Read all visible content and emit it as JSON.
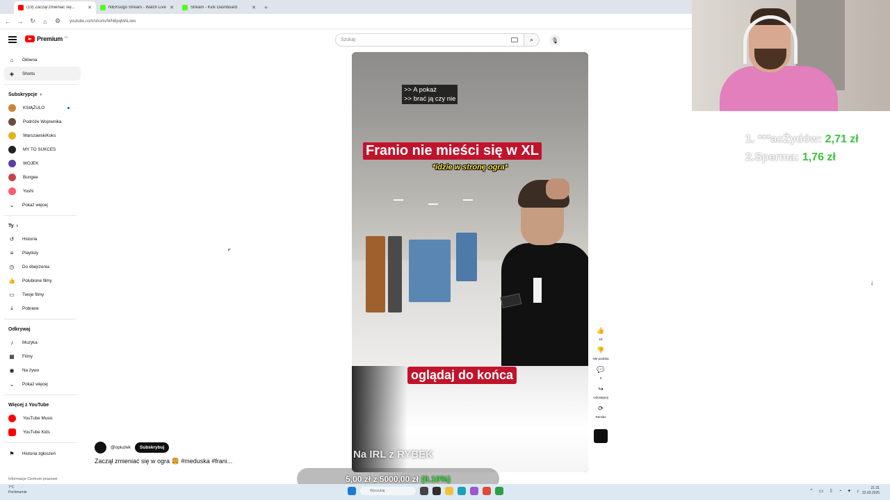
{
  "browser": {
    "tabs": [
      {
        "label": "(19) Zaczął zmieniać się...",
        "color": "#ff0000"
      },
      {
        "label": "NIEKsogo Stream - Watch Live",
        "color": "#53fc18"
      },
      {
        "label": "Stream - Kick Dashboard",
        "color": "#53fc18"
      }
    ],
    "new_tab": "+",
    "url": "youtube.com/shorts/WN6pqMALiwo"
  },
  "masthead": {
    "logo_text": "Premium",
    "logo_sup": "PL",
    "search_placeholder": "Szukaj"
  },
  "sidebar": {
    "main": [
      {
        "label": "Główna",
        "icon": "home-icon"
      },
      {
        "label": "Shorts",
        "icon": "shorts-icon",
        "active": true
      }
    ],
    "subs_header": "Subskrypcje",
    "subscriptions": [
      {
        "label": "KSIĄŻULO",
        "color": "#c9863a",
        "new": true
      },
      {
        "label": "Podróże Wojownika",
        "color": "#6a4b3a"
      },
      {
        "label": "WarszawskiKoks",
        "color": "#e8b21a"
      },
      {
        "label": "MY TO SUKCES",
        "color": "#222222"
      },
      {
        "label": "WOJEK",
        "color": "#5a3fa0"
      },
      {
        "label": "Bungee",
        "color": "#c8424a"
      },
      {
        "label": "Yoshi",
        "color": "#ff5a6e"
      }
    ],
    "subs_more": "Pokaż więcej",
    "you_header": "Ty",
    "you": [
      {
        "label": "Historia",
        "icon": "history-icon"
      },
      {
        "label": "Playlisty",
        "icon": "playlist-icon"
      },
      {
        "label": "Do obejrzenia",
        "icon": "watch-later-icon"
      },
      {
        "label": "Polubione filmy",
        "icon": "like-icon"
      },
      {
        "label": "Twoje filmy",
        "icon": "your-videos-icon"
      },
      {
        "label": "Pobrane",
        "icon": "download-icon"
      }
    ],
    "explore_header": "Odkrywaj",
    "explore": [
      {
        "label": "Muzyka",
        "icon": "music-icon"
      },
      {
        "label": "Filmy",
        "icon": "film-icon"
      },
      {
        "label": "Na żywo",
        "icon": "live-icon"
      },
      {
        "label": "Pokaż więcej",
        "icon": "chevron-down-icon"
      }
    ],
    "more_header": "Więcej z YouTube",
    "more": [
      {
        "label": "YouTube Music",
        "color": "#ff0000"
      },
      {
        "label": "YouTube Kids",
        "color": "#ff0000"
      }
    ],
    "report": "Historia zgłoszeń",
    "footer": "Informacje   Centrum prasowe"
  },
  "short": {
    "cc_lines": [
      ">> A pokaż",
      ">> brać ją czy nie"
    ],
    "title_overlay": "Franio nie mieści się w XL",
    "subtitle_overlay": "*idzie w stronę ogra*",
    "bottom_overlay": "oglądaj do końca",
    "watermark": "Na IRL z RYBEK",
    "channel": "@opiuzek",
    "subscribe": "Subskrybuj",
    "title": "Zaczął zmieniać się w ogra 🍔 #meduska #frani..."
  },
  "actions": [
    {
      "label": "19",
      "icon": "thumbs-up-icon"
    },
    {
      "label": "Nie podoba",
      "icon": "thumbs-down-icon"
    },
    {
      "label": "0",
      "icon": "comment-icon"
    },
    {
      "label": "Udostępnij",
      "icon": "share-icon"
    },
    {
      "label": "Remiks",
      "icon": "remix-icon"
    }
  ],
  "stream": {
    "leaderboard": [
      {
        "rank": "1. ***acŻydów:",
        "amount": "2,71 zł"
      },
      {
        "rank": "2.Sperma:",
        "amount": "1,76 zł"
      }
    ],
    "goal_text": "5,00 zł z 5000,00 zł",
    "goal_pct": "(0.10%)",
    "goal_fraction": 0.001
  },
  "taskbar": {
    "weather_temp": "7°C",
    "weather_desc": "Pochmurnie",
    "search": "Wyszukaj",
    "time": "21:31",
    "date": "22.03.2025"
  }
}
